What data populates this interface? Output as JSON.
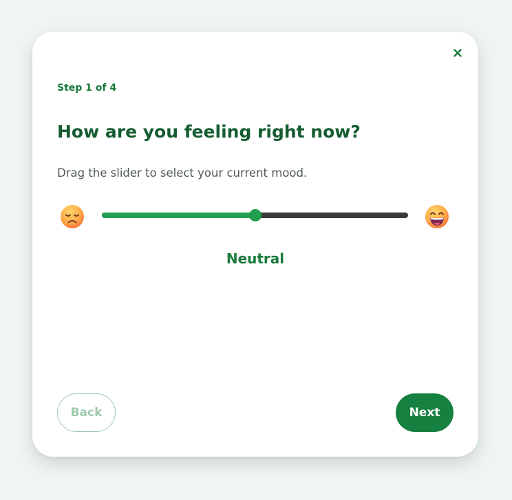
{
  "dialog": {
    "close_label": "×",
    "step_label": "Step 1 of 4",
    "title": "How are you feeling right now?",
    "subtitle": "Drag the slider to select your current mood."
  },
  "slider": {
    "value_fraction": 0.5,
    "left_icon": "sad-face-icon",
    "right_icon": "grinning-face-icon",
    "mood_label": "Neutral"
  },
  "buttons": {
    "back_label": "Back",
    "next_label": "Next"
  },
  "colors": {
    "accent": "#22a04f",
    "primary_button": "#168040",
    "title": "#145c30",
    "track": "#3a3a3a",
    "back_border": "#9fc9ad",
    "background": "#eff5f2"
  }
}
